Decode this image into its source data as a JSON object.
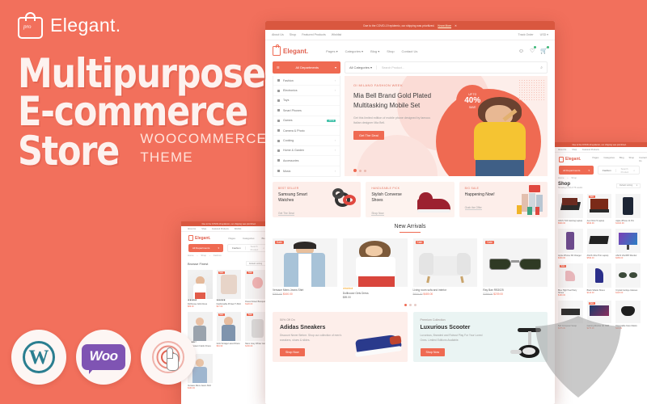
{
  "promo": {
    "logo_text": "Elegant.",
    "logo_icon": "shopping-bag-icon",
    "headline_line1": "Multipurpose",
    "headline_line2": "E-commerce",
    "headline_line3": "Store",
    "subtitle_line1": "WOOCOMMERCE",
    "subtitle_line2": "THEME",
    "badges": [
      {
        "name": "wordpress-badge",
        "label": "W"
      },
      {
        "name": "woocommerce-badge",
        "label": "Woo"
      },
      {
        "name": "responsive-click-badge",
        "label": ""
      }
    ],
    "background_color": "#f2705c"
  },
  "main_mockup": {
    "announcement": "Due to the COVID-19 epidemic, our shipping was prioritized.",
    "announcement_link": "Know More",
    "utility_links": [
      "About Us",
      "Shop",
      "Featured Products",
      "Wishlist"
    ],
    "utility_right": [
      "Track Order",
      "USD"
    ],
    "brand": "Elegant.",
    "nav": [
      "Pages",
      "Categories",
      "Blog",
      "Shop",
      "Contact Us"
    ],
    "header_icons": [
      "user-icon",
      "wishlist-heart-icon",
      "cart-icon"
    ],
    "departments_button": "All Departments",
    "search_category": "All Categories",
    "search_placeholder": "Search Product...",
    "categories": [
      {
        "label": "Fashion",
        "caret": true
      },
      {
        "label": "Electronics",
        "caret": true
      },
      {
        "label": "Toys",
        "caret": false
      },
      {
        "label": "Smart Phones",
        "caret": false
      },
      {
        "label": "Games",
        "badge": "-15 %"
      },
      {
        "label": "Camera & Photo",
        "caret": false
      },
      {
        "label": "Cooking",
        "caret": true
      },
      {
        "label": "Home & Garden",
        "caret": true
      },
      {
        "label": "Accessories",
        "caret": false
      },
      {
        "label": "Music",
        "caret": true
      }
    ],
    "hero": {
      "eyebrow": "OI MILANO FASHION WEEK",
      "title_line1": "Mia Bell Brand Gold Plated",
      "title_line2": "Multitasking Mobile Set",
      "desc_line1": "Get this limited edition of mobile phone designed by famous",
      "desc_line2": "Italian designer Mia Bell.",
      "cta": "Get The Deal",
      "save_top": "UP TO",
      "save_value": "40%",
      "save_bottom": "SAVE"
    },
    "promo_cards": [
      {
        "kicker": "BEST SELLER",
        "title_line1": "Samsung Smart",
        "title_line2": "Watches",
        "link": "Get The Deal",
        "bg": "#fdeeea",
        "art": "watches"
      },
      {
        "kicker": "HANDLEABLE PICK",
        "title_line1": "Stylish Converse",
        "title_line2": "Shoes",
        "link": "Shop Now",
        "bg": "#fdf3ef",
        "art": "sneaker"
      },
      {
        "kicker": "BIG SALE",
        "title_line1": "Happening Now!",
        "title_line2": "",
        "link": "Grab the Offer",
        "bg": "#fdeeea",
        "art": "shoppers"
      }
    ],
    "new_arrivals_title": "New Arrivals",
    "products": [
      {
        "name": "Versace Mens Jeans Shirt",
        "old_price": "$300.00",
        "price": "$160.00",
        "sale_badge": "Sale",
        "stars": "",
        "art": "man-shirt"
      },
      {
        "name": "Dollhouse Girls Dress",
        "old_price": "",
        "price": "$89.00",
        "sale_badge": "",
        "stars": "★★★★★",
        "art": "woman-dress"
      },
      {
        "name": "Living room sofa and interior",
        "old_price": "$600.00",
        "price": "$480.00",
        "sale_badge": "Sale",
        "stars": "",
        "art": "sofa"
      },
      {
        "name": "Ray Ban RB3025",
        "old_price": "$299.00",
        "price": "$239.00",
        "sale_badge": "Sale",
        "stars": "",
        "art": "sunglasses"
      }
    ],
    "banners": [
      {
        "kicker": "50% Off On",
        "title": "Adidas Sneakers",
        "desc_line1": "Discount Never Before. Shop our collection of men's",
        "desc_line2": "sneakers, shoes & slides.",
        "button": "Shop Now",
        "bg": "#fdeeea",
        "art": "blue-sneaker"
      },
      {
        "kicker": "Premium Collection",
        "title": "Luxurious Scooter",
        "desc_line1": "Luxurious, Branded and Robust Play For Your Loved",
        "desc_line2": "Ones. Limited Editions Available.",
        "button": "Shop Now",
        "bg": "#eaf4f3",
        "art": "scooter"
      }
    ]
  },
  "right_mockup": {
    "announcement": "Due to the COVID-19 epidemic, our shipping was prioritized.",
    "brand": "Elegant.",
    "nav": [
      "Pages",
      "Categories",
      "Blog",
      "Shop",
      "Contact Us"
    ],
    "departments_button": "All Departments",
    "search_category": "Fashion",
    "search_placeholder": "Search Product",
    "breadcrumb": [
      "Home",
      "Shop"
    ],
    "page_title": "Shop",
    "result_count": "Showing 1–16 of 75 results",
    "sort_label": "Default sorting",
    "products": [
      {
        "name": "ASUS TUF Gaming Laptop",
        "price": "$999.00",
        "sale": ""
      },
      {
        "name": "Acer Nitro 5 Laptop",
        "price": "$849.99",
        "sale": "Sale"
      },
      {
        "name": "Apple iPhone 11 Pro",
        "price": "$1020.99",
        "sale": ""
      },
      {
        "name": "Apple iPhone XR Charger",
        "price": "$349.00",
        "sale": ""
      },
      {
        "name": "ASUS Ultra Thin Laptop",
        "price": "$599.00",
        "sale": ""
      },
      {
        "name": "ASUS VG245H Monitor",
        "price": "$289.00",
        "sale": ""
      },
      {
        "name": "Blue High Heel Party Shoes",
        "price": "$160.00",
        "sale": "Sale"
      },
      {
        "name": "Black Stiletto Shoes",
        "price": "$144.00",
        "sale": ""
      },
      {
        "name": "Crystal Cat Eye Glasses",
        "price": "$120.00",
        "sale": ""
      },
      {
        "name": "Bell Computer Setup",
        "price": "$475.00",
        "sale": ""
      },
      {
        "name": "Gaming Monitor 4K HDR",
        "price": "$275.00",
        "sale": "Sale"
      },
      {
        "name": "Disposable Face Masks",
        "price": "$29.99",
        "sale": ""
      }
    ]
  },
  "bottom_mockup": {
    "announcement": "Due to the COVID-19 epidemic, our shipping was prioritized.",
    "brand": "Elegant.",
    "nav": [
      "Pages",
      "Categories",
      "Blog"
    ],
    "departments_button": "All Departments",
    "search_category": "Fashion",
    "search_placeholder": "Search Product",
    "breadcrumb": [
      "Home",
      "Shop",
      "Fashion"
    ],
    "page_title": "Browse Finest",
    "sort_label": "Default sorting",
    "products": [
      {
        "name": "Dollhouse Girls Dress",
        "price": "$89.00",
        "old_price": "",
        "sale": "",
        "stars": "★★★★★"
      },
      {
        "name": "Fashionable Printed T-Shirt",
        "price": "$47.00",
        "old_price": "$69.00",
        "sale": "Sale",
        "stars": "★★★★★"
      },
      {
        "name": "Dress Flower Bouquet",
        "price": "$120.00",
        "old_price": "",
        "sale": "Sale",
        "stars": ""
      },
      {
        "name": "Girl Western Fabric Dress",
        "price": "$44.99",
        "old_price": "",
        "sale": "",
        "stars": "★★★★☆"
      },
      {
        "name": "Girls Vintage Laced Dress",
        "price": "$64.99",
        "old_price": "$99.00",
        "sale": "Sale",
        "stars": ""
      },
      {
        "name": "Mens Grey Winter Jacket",
        "price": "$130.00",
        "old_price": "",
        "sale": "Sale",
        "stars": ""
      },
      {
        "name": "Versace Mens Jeans Shirt",
        "price": "$160.00",
        "old_price": "$300.00",
        "sale": "Sale",
        "stars": ""
      }
    ]
  },
  "theme": {
    "accent": "#ef6a52",
    "background": "#f2705c",
    "badge_green": "#3fc0a8",
    "sale_red": "#ef6a52"
  }
}
